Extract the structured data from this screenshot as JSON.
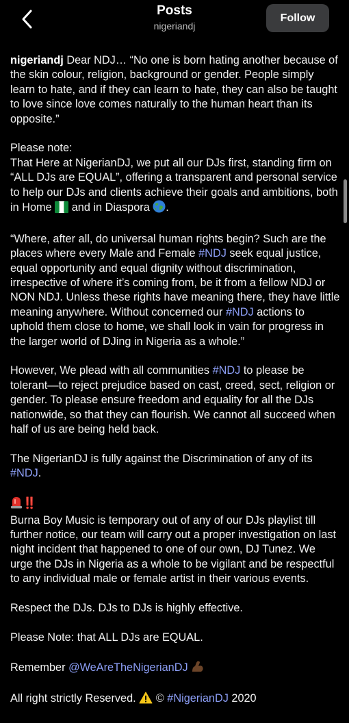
{
  "header": {
    "title": "Posts",
    "subtitle": "nigeriandj",
    "follow_label": "Follow"
  },
  "post": {
    "username": "nigeriandj",
    "p1": "Dear NDJ… “No one is born hating another because of the skin colour, religion, background or gender. People simply learn to hate, and if they can learn to hate, they can also be taught to love since love comes naturally to the human heart than its opposite.”",
    "p2_line1": "Please note:",
    "p2_text": "That Here at NigerianDJ, we put all our DJs first, standing firm on “ALL DJs are EQUAL”, offering a transparent and personal service to help our DJs and clients achieve their goals and ambitions, both in Home",
    "p2_mid": "and in Diaspora",
    "p2_end": ".",
    "p3_a": "“Where, after all, do universal human rights begin? Such are the places where every Male and Female",
    "p3_b": "seek equal justice, equal opportunity and equal dignity without discrimination, irrespective of where it’s coming from, be it from a fellow NDJ or NON NDJ. Unless these rights have meaning there, they have little meaning anywhere. Without concerned our",
    "p3_c": "actions to uphold them close to home, we shall look in vain for progress in the larger world of DJing in Nigeria as a whole.”",
    "p4_a": "However, We plead with all communities",
    "p4_b": "to please be tolerant—to reject prejudice based on cast, creed, sect, religion or gender. To please ensure freedom and equality for all the DJs nationwide, so that they can flourish. We cannot all succeed when half of us are being held back.",
    "p5_a": "The NigerianDJ is fully against the Discrimination of any of its",
    "p5_b": ".",
    "alert_marks": "‼️",
    "p6": "Burna Boy Music is temporary out of any of our DJs playlist till further notice, our team will carry out a proper investigation on last night incident that happened to one of our own, DJ Tunez. We urge the DJs in Nigeria as a whole to be vigilant and be respectful to any individual male or female artist in their various events.",
    "p7": "Respect the DJs. DJs to DJs is highly effective.",
    "p8": "Please Note: that ALL DJs are EQUAL.",
    "p9_a": "Remember",
    "mention": "@WeAreTheNigerianDJ",
    "p10_a": "All right strictly Reserved.",
    "copyright": "©",
    "hashtag_nigeriandj": "#NigerianDJ",
    "year": "2020",
    "hashtag_ndj": "#NDJ"
  },
  "icons": {
    "back": "chevron-left-icon",
    "flag": "nigeria-flag-icon",
    "globe": "globe-icon",
    "siren": "siren-icon",
    "flex": "flexed-biceps-icon",
    "warning": "warning-icon"
  },
  "colors": {
    "background": "#000000",
    "text": "#f0f0f0",
    "hashtag": "#8c9ef5",
    "follow_button_bg": "#3a3b3d"
  }
}
